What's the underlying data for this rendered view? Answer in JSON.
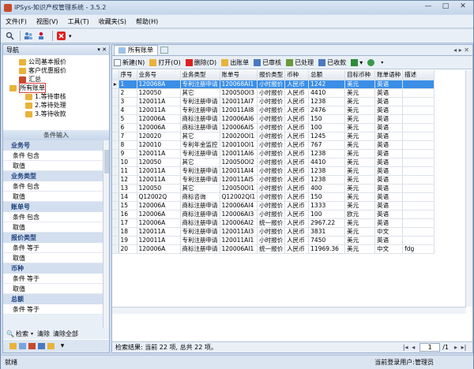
{
  "window": {
    "title": "IPSys-知识产权管理系统 - 3.5.2",
    "min": "—",
    "max": "□",
    "close": "✕"
  },
  "menu": [
    "文件(F)",
    "视图(V)",
    "工具(T)",
    "收藏夹(S)",
    "帮助(H)"
  ],
  "nav": {
    "title": "导航",
    "pin": "▾ ✕",
    "items": [
      {
        "label": "公司基本报价",
        "color": "#e9b33a",
        "indent": 16
      },
      {
        "label": "客户优惠报价",
        "color": "#e9b33a",
        "indent": 16
      },
      {
        "label": "汇总",
        "color": "#c94a2b",
        "indent": 16
      },
      {
        "label": "所有账单",
        "color": "#e9b33a",
        "indent": 4
      },
      {
        "label": "1.等待审核",
        "color": "#e9b33a",
        "indent": 24
      },
      {
        "label": "2.等待处理",
        "color": "#e9b33a",
        "indent": 24
      },
      {
        "label": "3.等待收款",
        "color": "#e9b33a",
        "indent": 24
      }
    ]
  },
  "conditions": {
    "title": "条件输入",
    "groups": [
      {
        "name": "业务号",
        "row1": [
          "条件",
          "包含"
        ],
        "row2": [
          "取值",
          ""
        ]
      },
      {
        "name": "业务类型",
        "row1": [
          "条件",
          "包含"
        ],
        "row2": [
          "取值",
          ""
        ]
      },
      {
        "name": "账单号",
        "row1": [
          "条件",
          "包含"
        ],
        "row2": [
          "取值",
          ""
        ]
      },
      {
        "name": "报价类型",
        "row1": [
          "条件",
          "等于"
        ],
        "row2": [
          "取值",
          ""
        ]
      },
      {
        "name": "币种",
        "row1": [
          "条件",
          "等于"
        ],
        "row2": [
          "取值",
          ""
        ]
      },
      {
        "name": "总额",
        "row1": [
          "条件",
          "等于"
        ],
        "row2": []
      }
    ],
    "footer": [
      "检索",
      "清除",
      "清除全部"
    ]
  },
  "tab": {
    "label": "所有账单",
    "nav": "◂ ▸ ✕"
  },
  "gridtoolbar": [
    "新建(N)",
    "打开(O)",
    "删除(D)",
    "出账单",
    "已审核",
    "已处理",
    "已收款"
  ],
  "grid": {
    "columns": [
      "序号",
      "业务号",
      "业务类型",
      "账单号",
      "报价类型",
      "币种",
      "总额",
      "目标币种",
      "账单语种",
      "描述"
    ],
    "widths": [
      8,
      23,
      55,
      42,
      37,
      33,
      30,
      46,
      38,
      33,
      40
    ],
    "rows": [
      [
        "1",
        "120068A",
        "专利注册申请",
        "120068AI1",
        "小时报价",
        "人民币",
        "1242",
        "美元",
        "英语",
        ""
      ],
      [
        "2",
        "120050",
        "其它",
        "120050OI3",
        "小时报价",
        "人民币",
        "4410",
        "美元",
        "英语",
        ""
      ],
      [
        "3",
        "120011A",
        "专利注册申请",
        "120011AI7",
        "小时报价",
        "人民币",
        "1238",
        "美元",
        "英语",
        ""
      ],
      [
        "4",
        "120011A",
        "专利注册申请",
        "120011AI8",
        "小时报价",
        "人民币",
        "2476",
        "美元",
        "英语",
        ""
      ],
      [
        "5",
        "120006A",
        "商标注册申请",
        "120006AI6",
        "小时报价",
        "人民币",
        "150",
        "美元",
        "英语",
        ""
      ],
      [
        "6",
        "120006A",
        "商标注册申请",
        "120006AI5",
        "小时报价",
        "人民币",
        "100",
        "美元",
        "英语",
        ""
      ],
      [
        "7",
        "120020",
        "其它",
        "120020OI1",
        "小时报价",
        "人民币",
        "1245",
        "美元",
        "英语",
        ""
      ],
      [
        "8",
        "120010",
        "专利年金监控",
        "120010OI1",
        "小时报价",
        "人民币",
        "767",
        "美元",
        "英语",
        ""
      ],
      [
        "9",
        "120011A",
        "专利注册申请",
        "120011AI6",
        "小时报价",
        "人民币",
        "1238",
        "美元",
        "英语",
        ""
      ],
      [
        "10",
        "120050",
        "其它",
        "120050OI2",
        "小时报价",
        "人民币",
        "4410",
        "美元",
        "英语",
        ""
      ],
      [
        "11",
        "120011A",
        "专利注册申请",
        "120011AI4",
        "小时报价",
        "人民币",
        "1238",
        "美元",
        "英语",
        ""
      ],
      [
        "12",
        "120011A",
        "专利注册申请",
        "120011AI5",
        "小时报价",
        "人民币",
        "1238",
        "美元",
        "英语",
        ""
      ],
      [
        "13",
        "120050",
        "其它",
        "120050OI1",
        "小时报价",
        "人民币",
        "400",
        "美元",
        "英语",
        ""
      ],
      [
        "14",
        "Q12002Q",
        "商标咨询",
        "Q12002QI1",
        "小时报价",
        "人民币",
        "150",
        "美元",
        "英语",
        ""
      ],
      [
        "15",
        "120006A",
        "商标注册申请",
        "120006AI4",
        "小时报价",
        "人民币",
        "1333",
        "美元",
        "英语",
        ""
      ],
      [
        "16",
        "120006A",
        "商标注册申请",
        "120006AI3",
        "小时报价",
        "人民币",
        "100",
        "欧元",
        "英语",
        ""
      ],
      [
        "17",
        "120006A",
        "商标注册申请",
        "120006AI2",
        "统一报价",
        "人民币",
        "2967.22",
        "美元",
        "英语",
        ""
      ],
      [
        "18",
        "120011A",
        "专利注册申请",
        "120011AI3",
        "小时报价",
        "人民币",
        "3831",
        "美元",
        "中文",
        ""
      ],
      [
        "19",
        "120011A",
        "专利注册申请",
        "120011AI1",
        "小时报价",
        "人民币",
        "7450",
        "美元",
        "英语",
        ""
      ],
      [
        "20",
        "120006A",
        "商标注册申请",
        "120006AI1",
        "统一报价",
        "人民币",
        "11969.36",
        "美元",
        "中文",
        "fdg"
      ]
    ]
  },
  "gridstatus": {
    "text": "检索结果: 当前 22 项, 总共 22 项。",
    "page": "1",
    "total": "/1"
  },
  "status": {
    "left": "就绪",
    "user": "当前登录用户:管理员"
  }
}
